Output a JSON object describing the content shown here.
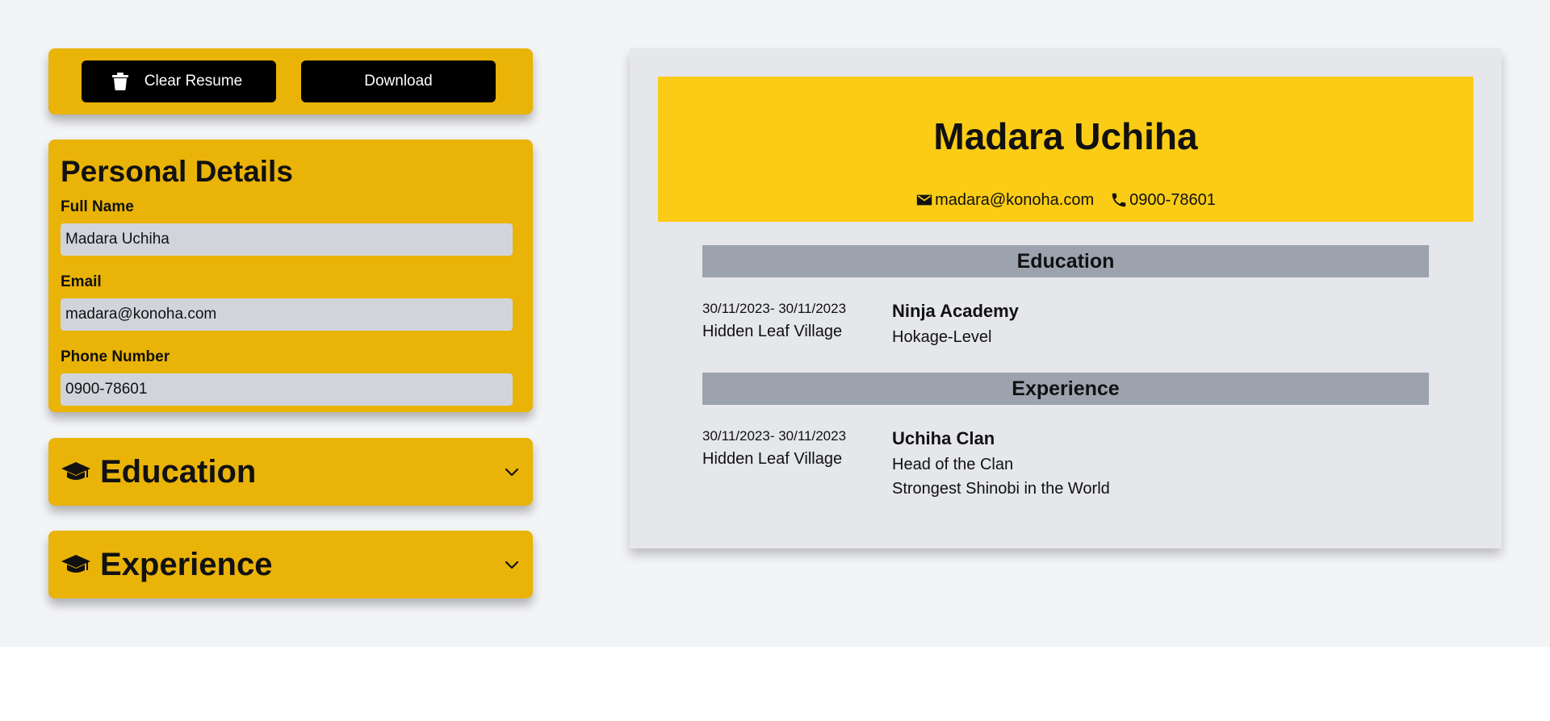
{
  "toolbar": {
    "clear_label": "Clear Resume",
    "download_label": "Download",
    "trash_icon": "trash-icon"
  },
  "personal": {
    "heading": "Personal Details",
    "full_name_label": "Full Name",
    "full_name_value": "Madara Uchiha",
    "email_label": "Email",
    "email_value": "madara@konoha.com",
    "phone_label": "Phone Number",
    "phone_value": "0900-78601"
  },
  "sections": {
    "education_title": "Education",
    "experience_title": "Experience",
    "section_icon": "graduation-cap-icon",
    "toggle_icon": "chevron-down-icon"
  },
  "resume": {
    "name": "Madara Uchiha",
    "email": "madara@konoha.com",
    "phone": "0900-78601",
    "email_icon": "mail-icon",
    "phone_icon": "phone-icon",
    "education_heading": "Education",
    "education_entry": {
      "dates": "30/11/2023- 30/11/2023",
      "location": "Hidden Leaf Village",
      "title": "Ninja Academy",
      "detail": "Hokage-Level"
    },
    "experience_heading": "Experience",
    "experience_entry": {
      "dates": "30/11/2023- 30/11/2023",
      "location": "Hidden Leaf Village",
      "title": "Uchiha Clan",
      "detail_1": "Head of the Clan",
      "detail_2": "Strongest Shinobi in the World"
    }
  },
  "colors": {
    "panel_yellow": "#e9b308",
    "header_yellow": "#facc15",
    "section_gray": "#9ca3af",
    "paper": "#e5e7eb",
    "background": "#f3f4f6"
  }
}
